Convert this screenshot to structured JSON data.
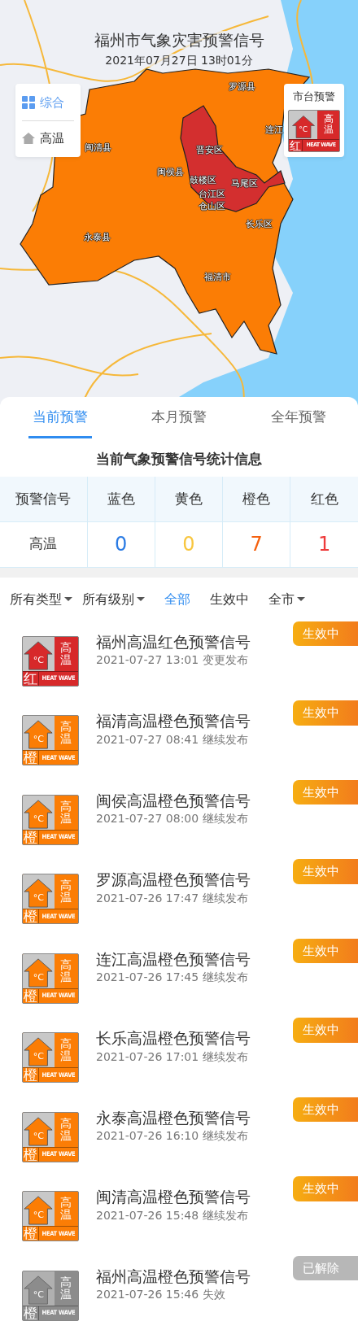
{
  "map": {
    "title": "福州市气象灾害预警信号",
    "timestamp": "2021年07月27日 13时01分",
    "layers": [
      {
        "label": "综合",
        "selected": true
      },
      {
        "label": "高温",
        "selected": false
      }
    ],
    "city_warning": {
      "label": "市台预警",
      "sign": {
        "grade": "红",
        "type": "高温",
        "english": "HEAT WAVE",
        "unit": "°C",
        "color": "#d7292a"
      }
    },
    "regions": [
      {
        "name": "罗源县"
      },
      {
        "name": "连江"
      },
      {
        "name": "闽清县"
      },
      {
        "name": "晋安区"
      },
      {
        "name": "闽侯县"
      },
      {
        "name": "鼓楼区"
      },
      {
        "name": "马尾区"
      },
      {
        "name": "台江区"
      },
      {
        "name": "仓山区"
      },
      {
        "name": "长乐区"
      },
      {
        "name": "永泰县"
      },
      {
        "name": "福清市"
      }
    ]
  },
  "tabs": [
    {
      "label": "当前预警",
      "selected": true
    },
    {
      "label": "本月预警",
      "selected": false
    },
    {
      "label": "全年预警",
      "selected": false
    }
  ],
  "stats": {
    "title": "当前气象预警信号统计信息",
    "columns": [
      {
        "label": "预警信号"
      },
      {
        "label": "蓝色"
      },
      {
        "label": "黄色"
      },
      {
        "label": "橙色"
      },
      {
        "label": "红色"
      }
    ],
    "rows": [
      {
        "type": "高温",
        "counts": [
          {
            "value": "0",
            "color": "#2a7be4"
          },
          {
            "value": "0",
            "color": "#f8c63f"
          },
          {
            "value": "7",
            "color": "#f5610f"
          },
          {
            "value": "1",
            "color": "#ee3b3b"
          }
        ]
      }
    ]
  },
  "filters": [
    {
      "label": "所有类型",
      "dropdown": true,
      "selected": false
    },
    {
      "label": "所有级别",
      "dropdown": true,
      "selected": false
    },
    {
      "label": "全部",
      "dropdown": false,
      "selected": true
    },
    {
      "label": "生效中",
      "dropdown": false,
      "selected": false
    },
    {
      "label": "全市",
      "dropdown": true,
      "selected": false
    }
  ],
  "warnings": [
    {
      "sign": {
        "grade": "红",
        "type": "高温",
        "english": "HEAT WAVE",
        "unit": "°C",
        "color": "#d7292a"
      },
      "title": "福州高温红色预警信号",
      "meta": "2021-07-27 13:01 变更发布",
      "status": {
        "text": "生效中",
        "kind": "active"
      }
    },
    {
      "sign": {
        "grade": "橙",
        "type": "高温",
        "english": "HEAT WAVE",
        "unit": "°C",
        "color": "#fb7d05"
      },
      "title": "福清高温橙色预警信号",
      "meta": "2021-07-27 08:41 继续发布",
      "status": {
        "text": "生效中",
        "kind": "active"
      }
    },
    {
      "sign": {
        "grade": "橙",
        "type": "高温",
        "english": "HEAT WAVE",
        "unit": "°C",
        "color": "#fb7d05"
      },
      "title": "闽侯高温橙色预警信号",
      "meta": "2021-07-27 08:00 继续发布",
      "status": {
        "text": "生效中",
        "kind": "active"
      }
    },
    {
      "sign": {
        "grade": "橙",
        "type": "高温",
        "english": "HEAT WAVE",
        "unit": "°C",
        "color": "#fb7d05"
      },
      "title": "罗源高温橙色预警信号",
      "meta": "2021-07-26 17:47 继续发布",
      "status": {
        "text": "生效中",
        "kind": "active"
      }
    },
    {
      "sign": {
        "grade": "橙",
        "type": "高温",
        "english": "HEAT WAVE",
        "unit": "°C",
        "color": "#fb7d05"
      },
      "title": "连江高温橙色预警信号",
      "meta": "2021-07-26 17:45 继续发布",
      "status": {
        "text": "生效中",
        "kind": "active"
      }
    },
    {
      "sign": {
        "grade": "橙",
        "type": "高温",
        "english": "HEAT WAVE",
        "unit": "°C",
        "color": "#fb7d05"
      },
      "title": "长乐高温橙色预警信号",
      "meta": "2021-07-26 17:01 继续发布",
      "status": {
        "text": "生效中",
        "kind": "active"
      }
    },
    {
      "sign": {
        "grade": "橙",
        "type": "高温",
        "english": "HEAT WAVE",
        "unit": "°C",
        "color": "#fb7d05"
      },
      "title": "永泰高温橙色预警信号",
      "meta": "2021-07-26 16:10 继续发布",
      "status": {
        "text": "生效中",
        "kind": "active"
      }
    },
    {
      "sign": {
        "grade": "橙",
        "type": "高温",
        "english": "HEAT WAVE",
        "unit": "°C",
        "color": "#fb7d05"
      },
      "title": "闽清高温橙色预警信号",
      "meta": "2021-07-26 15:48 继续发布",
      "status": {
        "text": "生效中",
        "kind": "active"
      }
    },
    {
      "sign": {
        "grade": "橙",
        "type": "高温",
        "english": "HEAT WAVE",
        "unit": "°C",
        "color": "#8c8c8c"
      },
      "title": "福州高温橙色预警信号",
      "meta": "2021-07-26 15:46 失效",
      "status": {
        "text": "已解除",
        "kind": "lifted"
      }
    }
  ]
}
